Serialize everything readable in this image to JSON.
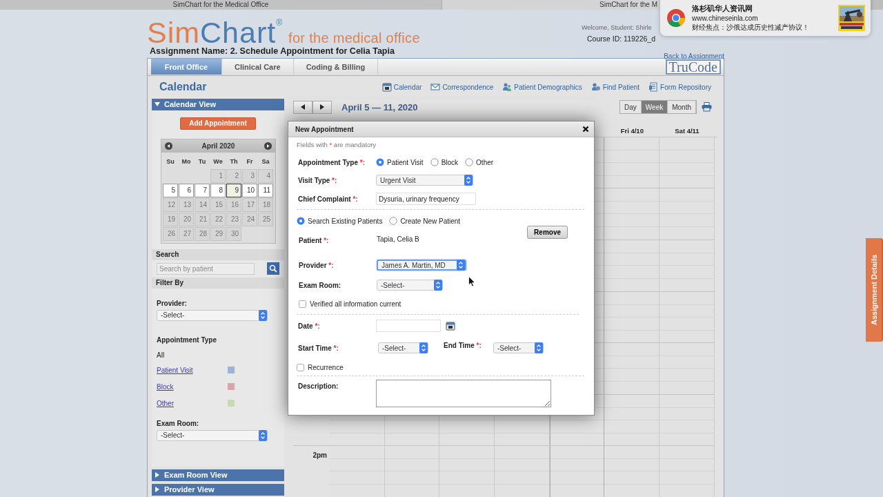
{
  "browser_tabs": [
    {
      "title": "SimChart for the Medical Office",
      "selected": true
    },
    {
      "title": "SimChart for the M",
      "selected": false
    }
  ],
  "header": {
    "logo_first": "Sim",
    "logo_second": "Chart",
    "logo_mark": "®",
    "logo_tagline": "for the medical office",
    "welcome": "Welcome, Student: Shirle",
    "course_id": "Course ID: 119226_d",
    "back_link": "Back to Assignment",
    "assignment_name": "Assignment Name:  2. Schedule Appointment for Celia Tapia"
  },
  "module_tabs": [
    {
      "label": "Front Office",
      "selected": true
    },
    {
      "label": "Clinical Care",
      "selected": false
    },
    {
      "label": "Coding & Billing",
      "selected": false
    }
  ],
  "trucode_logo": "TruCode",
  "page_title": "Calendar",
  "toolbar_links": [
    {
      "label": "Calendar",
      "kind": "calendar"
    },
    {
      "label": "Correspondence",
      "kind": "envelope"
    },
    {
      "label": "Patient Demographics",
      "kind": "people"
    },
    {
      "label": "Find Patient",
      "kind": "person"
    },
    {
      "label": "Form Repository",
      "kind": "form"
    }
  ],
  "sidebar": {
    "calendar_view": {
      "label": "Calendar View",
      "expanded": true
    },
    "add_button": "Add Appointment",
    "mini_calendar": {
      "title": "April 2020",
      "weekdays": [
        "Su",
        "Mo",
        "Tu",
        "We",
        "Th",
        "Fr",
        "Sa"
      ],
      "weeks": [
        {
          "days": [
            {
              "day": "1",
              "selected": false,
              "today": false
            },
            {
              "day": "2",
              "selected": false,
              "today": false
            },
            {
              "day": "3",
              "selected": false,
              "today": false
            },
            {
              "day": "4",
              "selected": false,
              "today": false
            }
          ]
        },
        {
          "days": [
            {
              "day": "5",
              "selected": true,
              "today": false
            },
            {
              "day": "6",
              "selected": true,
              "today": false
            },
            {
              "day": "7",
              "selected": true,
              "today": false
            },
            {
              "day": "8",
              "selected": true,
              "today": false
            },
            {
              "day": "9",
              "selected": true,
              "today": true
            },
            {
              "day": "10",
              "selected": true,
              "today": false
            },
            {
              "day": "11",
              "selected": true,
              "today": false
            }
          ]
        },
        {
          "days": [
            {
              "day": "12",
              "selected": false,
              "today": false
            },
            {
              "day": "13",
              "selected": false,
              "today": false
            },
            {
              "day": "14",
              "selected": false,
              "today": false
            },
            {
              "day": "15",
              "selected": false,
              "today": false
            },
            {
              "day": "16",
              "selected": false,
              "today": false
            },
            {
              "day": "17",
              "selected": false,
              "today": false
            },
            {
              "day": "18",
              "selected": false,
              "today": false
            }
          ]
        },
        {
          "days": [
            {
              "day": "19",
              "selected": false,
              "today": false
            },
            {
              "day": "20",
              "selected": false,
              "today": false
            },
            {
              "day": "21",
              "selected": false,
              "today": false
            },
            {
              "day": "22",
              "selected": false,
              "today": false
            },
            {
              "day": "23",
              "selected": false,
              "today": false
            },
            {
              "day": "24",
              "selected": false,
              "today": false
            },
            {
              "day": "25",
              "selected": false,
              "today": false
            }
          ]
        },
        {
          "days": [
            {
              "day": "26",
              "selected": false,
              "today": false
            },
            {
              "day": "27",
              "selected": false,
              "today": false
            },
            {
              "day": "28",
              "selected": false,
              "today": false
            },
            {
              "day": "29",
              "selected": false,
              "today": false
            },
            {
              "day": "30",
              "selected": false,
              "today": false
            }
          ]
        }
      ]
    },
    "search_heading": "Search",
    "search_placeholder": "Search by patient",
    "filter_heading": "Filter By",
    "provider_label": "Provider:",
    "provider_value": "-Select-",
    "type_heading": "Appointment Type",
    "type_all": "All",
    "types": [
      {
        "label": "Patient Visit",
        "color": "#9db3d6"
      },
      {
        "label": "Block",
        "color": "#d8a3ad"
      },
      {
        "label": "Other",
        "color": "#c6dbb0"
      }
    ],
    "exam_room_label": "Exam Room:",
    "exam_room_value": "-Select-",
    "collapsed_sections": [
      {
        "label": "Exam Room View",
        "expanded": false
      },
      {
        "label": "Provider View",
        "expanded": false
      }
    ]
  },
  "calendar": {
    "title": "April 5 — 11, 2020",
    "views": [
      {
        "label": "Day",
        "selected": false
      },
      {
        "label": "Week",
        "selected": true
      },
      {
        "label": "Month",
        "selected": false
      }
    ],
    "day_headers": [
      "Fri 4/10",
      "Sat 4/11"
    ],
    "time_label": "2pm"
  },
  "dialog": {
    "title": "New Appointment",
    "note_before": "Fields with",
    "note_mark": "*",
    "note_after": "are mandatory",
    "type_label": "Appointment Type",
    "type_mark": "*:",
    "type_options": [
      {
        "label": "Patient Visit",
        "selected": true
      },
      {
        "label": "Block",
        "selected": false
      },
      {
        "label": "Other",
        "selected": false
      }
    ],
    "visit_label": "Visit Type",
    "visit_mark": "*:",
    "visit_value": "Urgent Visit",
    "complaint_label": "Chief Complaint",
    "complaint_mark": "*:",
    "complaint_value": "Dysuria, urinary frequency",
    "patient_modes": [
      {
        "label": "Search Existing Patients",
        "selected": true
      },
      {
        "label": "Create New Patient",
        "selected": false
      }
    ],
    "patient_label": "Patient",
    "patient_mark": "*:",
    "patient_value": "Tapia, Celia B",
    "remove_button": "Remove",
    "provider_label": "Provider",
    "provider_mark": "*:",
    "provider_value": "James A. Martin, MD",
    "provider_focused": true,
    "room_label": "Exam Room:",
    "room_value": "-Select-",
    "verified": {
      "label": "Verified all information current",
      "checked": false
    },
    "date_label": "Date",
    "date_mark": "*:",
    "start_label": "Start Time",
    "start_mark": "*:",
    "start_value": "-Select-",
    "end_label": "End Time",
    "end_mark": "*:",
    "end_value": "-Select-",
    "recurrence": {
      "label": "Recurrence",
      "checked": false
    },
    "description_label": "Description:"
  },
  "notification": {
    "title": "洛杉矶华人资讯网",
    "source": "www.chineseinla.com",
    "message": "财经焦点：沙俄达成历史性减产协议！"
  },
  "side_tab": "Assignment Details"
}
